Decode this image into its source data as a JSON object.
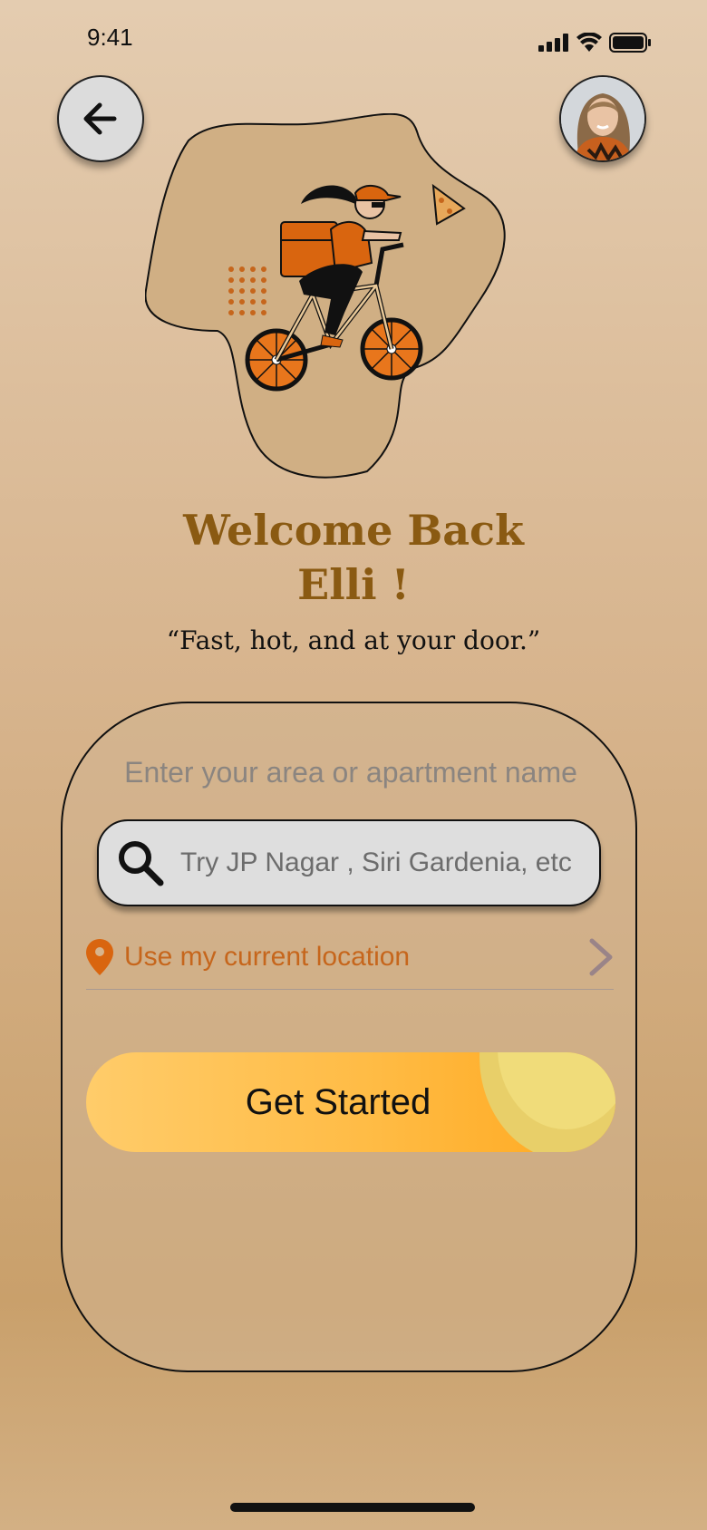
{
  "status_bar": {
    "time": "9:41"
  },
  "header": {
    "back_icon": "arrow-left-icon",
    "avatar_alt": "profile avatar"
  },
  "hero": {
    "illustration": "delivery-rider-on-bicycle-with-pizza"
  },
  "welcome": {
    "line1": "Welcome Back",
    "line2": "Elli !"
  },
  "tagline": "“Fast, hot, and at your door.”",
  "location_card": {
    "heading": "Enter your area or apartment name",
    "search_placeholder": "Try JP Nagar , Siri Gardenia, etc",
    "search_value": "",
    "current_location_label": "Use my current location",
    "get_started_label": "Get Started"
  },
  "colors": {
    "title": "#8a5a12",
    "location_accent": "#c6661c",
    "button_gradient_start": "#ffcc6a",
    "button_gradient_end": "#ffa71c"
  }
}
